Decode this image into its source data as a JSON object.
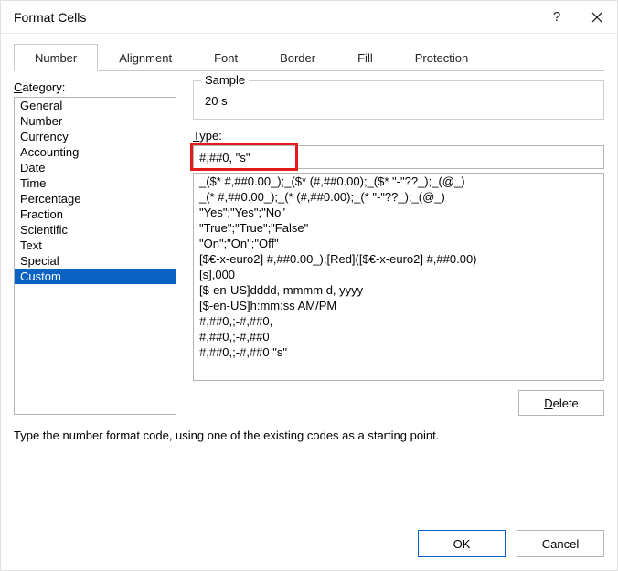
{
  "window": {
    "title": "Format Cells",
    "help_char": "?",
    "close_label": "Close"
  },
  "tabs": {
    "items": [
      {
        "label": "Number",
        "active": true
      },
      {
        "label": "Alignment",
        "active": false
      },
      {
        "label": "Font",
        "active": false
      },
      {
        "label": "Border",
        "active": false
      },
      {
        "label": "Fill",
        "active": false
      },
      {
        "label": "Protection",
        "active": false
      }
    ]
  },
  "category": {
    "label_pre": "C",
    "label_post": "ategory:",
    "items": [
      "General",
      "Number",
      "Currency",
      "Accounting",
      "Date",
      "Time",
      "Percentage",
      "Fraction",
      "Scientific",
      "Text",
      "Special",
      "Custom"
    ],
    "selected_index": 11
  },
  "sample": {
    "legend": "Sample",
    "value": "20 s"
  },
  "type": {
    "label_pre": "T",
    "label_post": "ype:",
    "value": "#,##0, \"s\"",
    "list": [
      "_($* #,##0.00_);_($* (#,##0.00);_($* \"-\"??_);_(@_)",
      "_(* #,##0.00_);_(* (#,##0.00);_(* \"-\"??_);_(@_)",
      "\"Yes\";\"Yes\";\"No\"",
      "\"True\";\"True\";\"False\"",
      "\"On\";\"On\";\"Off\"",
      "[$€-x-euro2] #,##0.00_);[Red]([$€-x-euro2] #,##0.00)",
      "[s],000",
      "[$-en-US]dddd, mmmm d, yyyy",
      "[$-en-US]h:mm:ss AM/PM",
      "#,##0,;-#,##0,",
      "#,##0,;-#,##0",
      "#,##0,;-#,##0 \"s\""
    ]
  },
  "buttons": {
    "delete_pre": "D",
    "delete_post": "elete",
    "ok": "OK",
    "cancel": "Cancel"
  },
  "hint": "Type the number format code, using one of the existing codes as a starting point."
}
